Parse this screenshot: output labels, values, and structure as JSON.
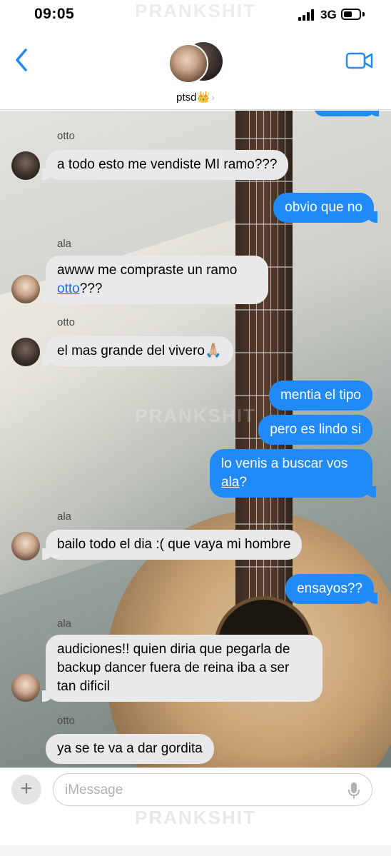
{
  "status_bar": {
    "time": "09:05",
    "network": "3G"
  },
  "watermark": "PRANKSHIT",
  "header": {
    "contact_name": "ptsd👑",
    "chevron": "›"
  },
  "icons": {
    "back": "chevron-left-icon",
    "video": "video-camera-icon",
    "mic": "microphone-icon",
    "plus": "plus-icon"
  },
  "colors": {
    "outgoing": "#1f8af8",
    "incoming": "#e9e9eb",
    "accent": "#1f8af8"
  },
  "messages": [
    {
      "direction": "in",
      "sender": "otto",
      "text": "a todo esto me vendiste MI ramo???"
    },
    {
      "direction": "out",
      "text": "obvio que no"
    },
    {
      "direction": "in",
      "sender": "ala",
      "text_before": "awww me compraste un ramo",
      "mention": "otto",
      "text_after": "???"
    },
    {
      "direction": "in",
      "sender": "otto",
      "text": "el mas grande del vivero🙏🏼"
    },
    {
      "direction": "out",
      "text": "mentia el tipo"
    },
    {
      "direction": "out",
      "text": "pero es lindo si"
    },
    {
      "direction": "out",
      "text_before": "lo venis a buscar vos",
      "mention": "ala",
      "text_after": "?"
    },
    {
      "direction": "in",
      "sender": "ala",
      "text": "bailo todo el dia :( que vaya mi hombre"
    },
    {
      "direction": "out",
      "text": "ensayos??"
    },
    {
      "direction": "in",
      "sender": "ala",
      "lines": [
        "audiciones!! quien diria que pegarla de",
        "backup dancer fuera de reina iba a ser",
        "tan dificil"
      ]
    },
    {
      "direction": "in",
      "sender": "otto",
      "text": "ya se te va a dar gordita"
    }
  ],
  "input": {
    "placeholder": "iMessage",
    "plus_label": "+"
  }
}
